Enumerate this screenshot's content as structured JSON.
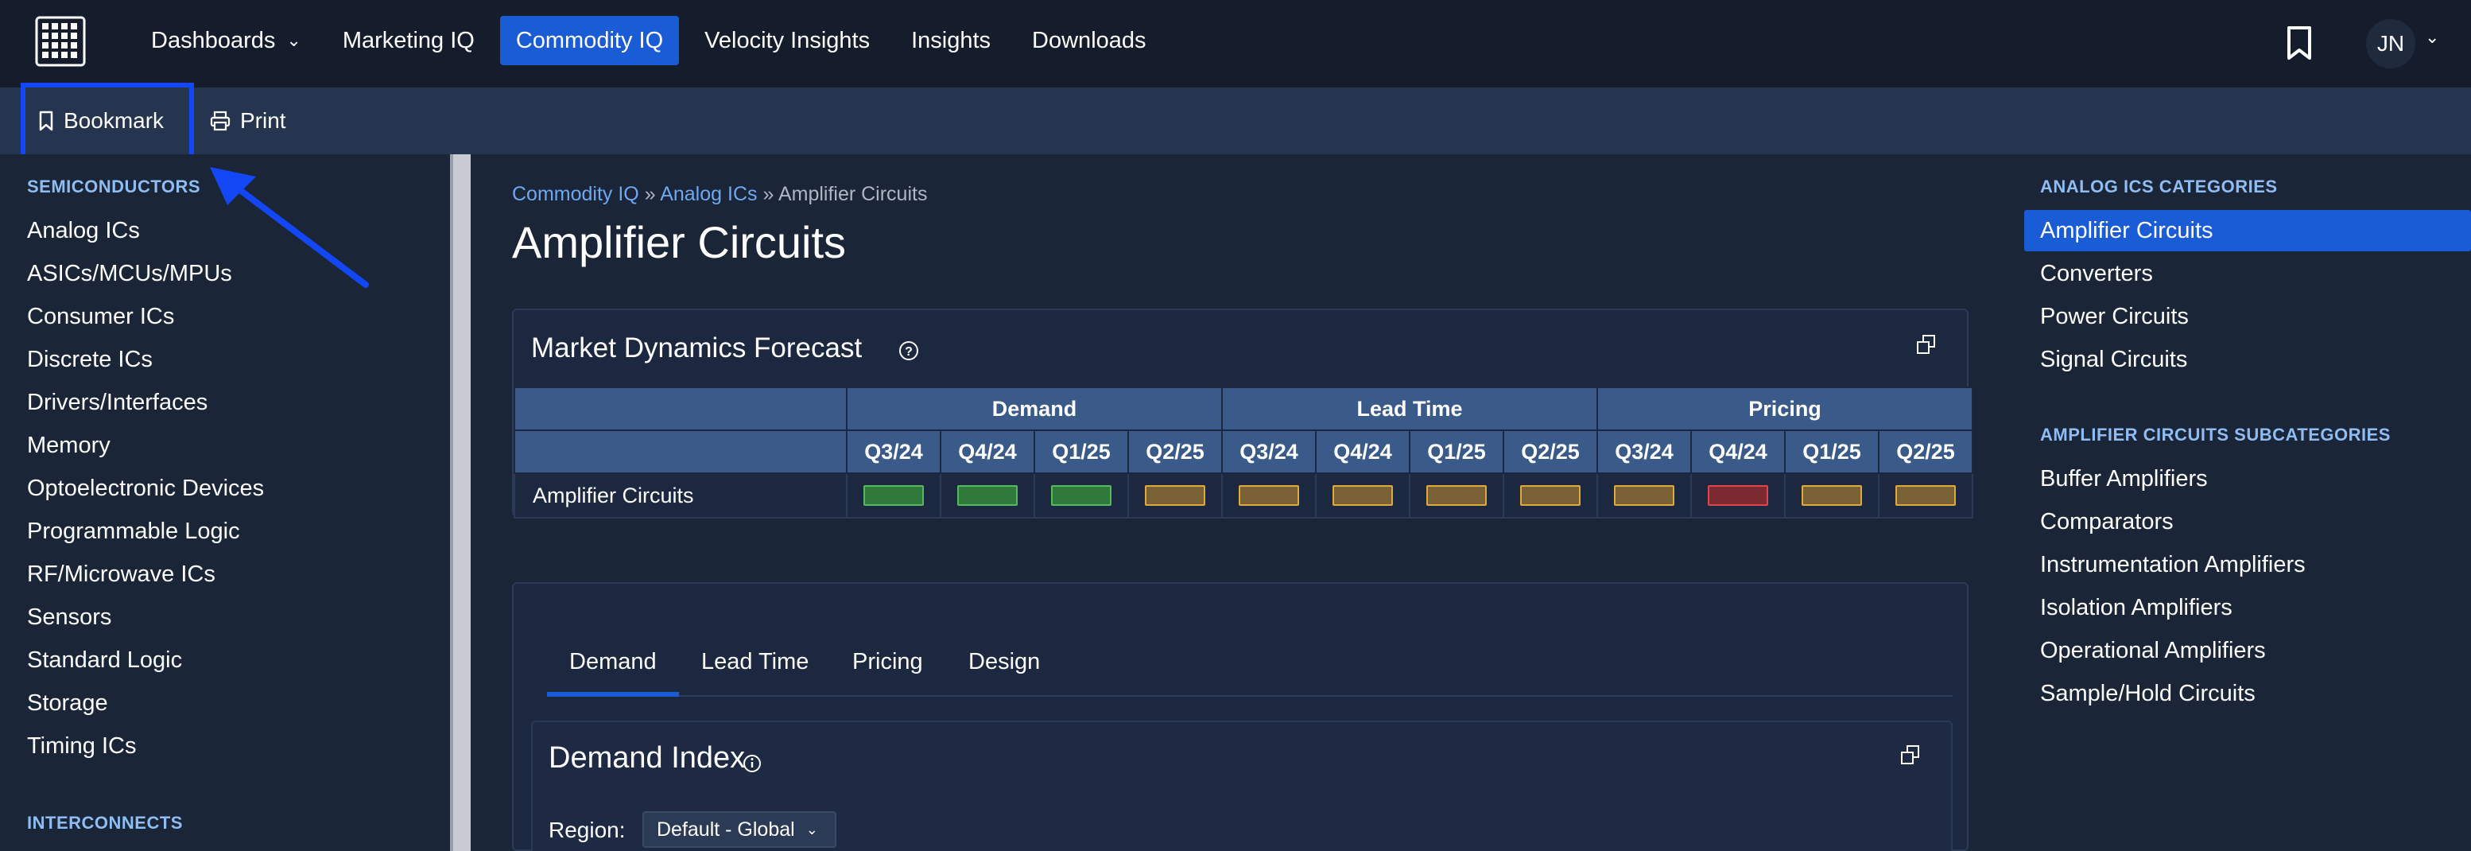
{
  "topnav": {
    "items": [
      {
        "label": "Dashboards",
        "has_dropdown": true
      },
      {
        "label": "Marketing IQ"
      },
      {
        "label": "Commodity IQ",
        "active": true
      },
      {
        "label": "Velocity Insights"
      },
      {
        "label": "Insights"
      },
      {
        "label": "Downloads"
      }
    ],
    "user_initials": "JN"
  },
  "toolbar": {
    "bookmark_label": "Bookmark",
    "print_label": "Print"
  },
  "sidebar": {
    "section1": "SEMICONDUCTORS",
    "items": [
      {
        "label": "Analog ICs"
      },
      {
        "label": "ASICs/MCUs/MPUs"
      },
      {
        "label": "Consumer ICs"
      },
      {
        "label": "Discrete ICs"
      },
      {
        "label": "Drivers/Interfaces"
      },
      {
        "label": "Memory"
      },
      {
        "label": "Optoelectronic Devices"
      },
      {
        "label": "Programmable Logic"
      },
      {
        "label": "RF/Microwave ICs"
      },
      {
        "label": "Sensors"
      },
      {
        "label": "Standard Logic"
      },
      {
        "label": "Storage"
      },
      {
        "label": "Timing ICs"
      }
    ],
    "section2": "INTERCONNECTS"
  },
  "breadcrumb": {
    "link1": "Commodity IQ",
    "sep": "»",
    "link2": "Analog ICs",
    "current": "Amplifier Circuits"
  },
  "page_title": "Amplifier Circuits",
  "forecast": {
    "title": "Market Dynamics Forecast",
    "groups": [
      "Demand",
      "Lead Time",
      "Pricing"
    ],
    "quarters": [
      "Q3/24",
      "Q4/24",
      "Q1/25",
      "Q2/25",
      "Q3/24",
      "Q4/24",
      "Q1/25",
      "Q2/25",
      "Q3/24",
      "Q4/24",
      "Q1/25",
      "Q2/25"
    ],
    "row_label": "Amplifier Circuits",
    "statuses": [
      "green",
      "green",
      "green",
      "amber",
      "amber",
      "amber",
      "amber",
      "amber",
      "amber",
      "red",
      "amber",
      "amber"
    ],
    "colors": {
      "green": {
        "fill": "#2f7a3a",
        "border": "#57b85f"
      },
      "amber": {
        "fill": "#7a6236",
        "border": "#e0a93a"
      },
      "red": {
        "fill": "#7a2a30",
        "border": "#e0444d"
      }
    }
  },
  "detail": {
    "tabs": [
      "Demand",
      "Lead Time",
      "Pricing",
      "Design"
    ],
    "active_tab": "Demand",
    "demand_index_title": "Demand Index",
    "region_label": "Region:",
    "region_value": "Default - Global"
  },
  "right_panel": {
    "categories_title": "ANALOG ICS CATEGORIES",
    "categories": [
      "Amplifier Circuits",
      "Converters",
      "Power Circuits",
      "Signal Circuits"
    ],
    "active_category": "Amplifier Circuits",
    "subcategories_title": "AMPLIFIER CIRCUITS SUBCATEGORIES",
    "subcategories": [
      "Buffer Amplifiers",
      "Comparators",
      "Instrumentation Amplifiers",
      "Isolation Amplifiers",
      "Operational Amplifiers",
      "Sample/Hold Circuits"
    ]
  },
  "accent_color": "#1a5bd6",
  "annotation_color": "#1346f5"
}
